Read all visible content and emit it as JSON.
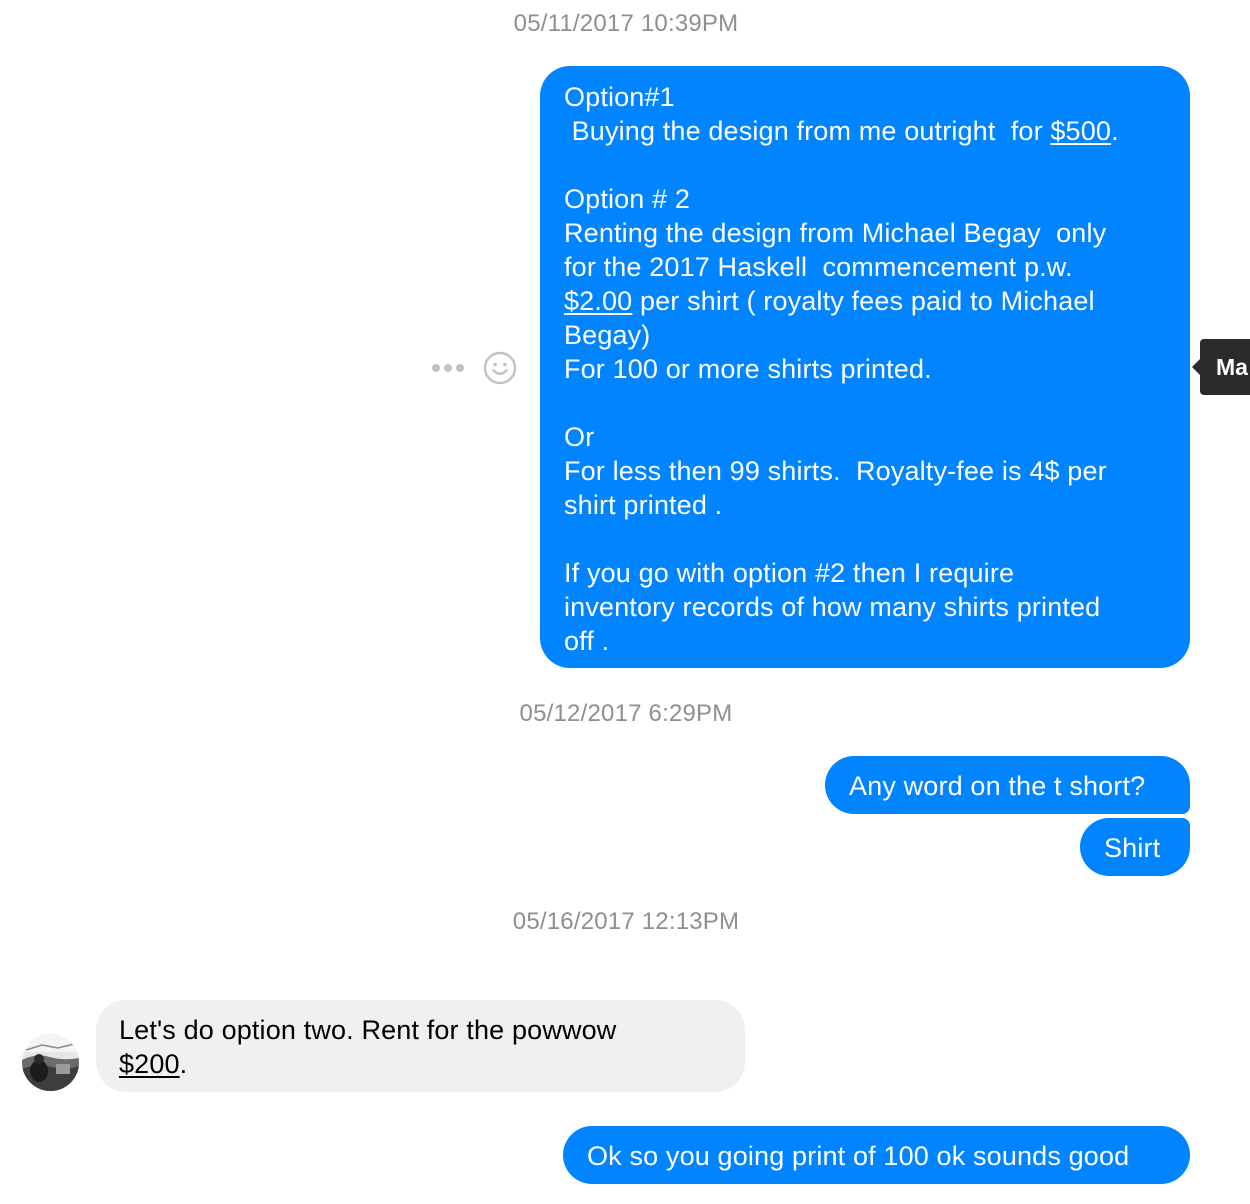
{
  "conversation": {
    "timestamps": [
      "05/11/2017 10:39PM",
      "05/12/2017 6:29PM",
      "05/16/2017 12:13PM"
    ],
    "msg1": {
      "l1": "Option#1",
      "l2a": " Buying the design from me outright  for ",
      "l2b": "$500",
      "l2c": ".",
      "l3": "Option # 2",
      "l4": "Renting the design from Michael Begay  only",
      "l5": "for the 2017 Haskell  commencement p.w.",
      "l6a": "$2.00",
      "l6b": " per shirt ( royalty fees paid to Michael",
      "l7": "Begay)",
      "l8": "For 100 or more shirts printed.",
      "l9": "Or",
      "l10": "For less then 99 shirts.  Royalty-fee is 4$ per",
      "l11": "shirt printed .",
      "l12": "If you go with option #2 then I require",
      "l13": "inventory records of how many shirts printed",
      "l14": "off ."
    },
    "msg2": "Any word on the t short?",
    "msg3": "Shirt",
    "msg4": {
      "l1": "Let's do option two. Rent for the powwow",
      "l2a": "$200",
      "l2b": "."
    },
    "msg5": "Ok so you going print of 100 ok sounds good"
  },
  "tooltip": {
    "text": "Ma"
  },
  "message_actions": {
    "more_icon": "more-dots-icon",
    "react_icon": "smiley-icon"
  },
  "colors": {
    "outgoing_bubble": "#0084ff",
    "incoming_bubble": "#f1f0f0",
    "timestamp_text": "#8e8e93",
    "tooltip_bg": "#2b2b2b"
  }
}
